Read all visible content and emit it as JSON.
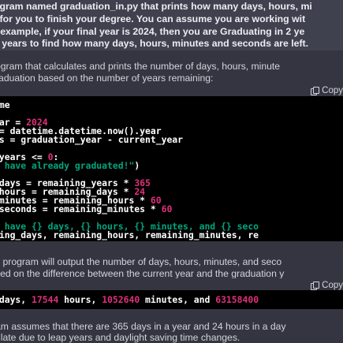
{
  "colors": {
    "page_bg": "#343541",
    "user_bg": "#40414f",
    "code_bg": "#000000",
    "number": "#df3079",
    "string": "#00a67d",
    "keyword": "#2e95d3"
  },
  "user_message": {
    "lines": [
      "ogram named graduation_in.py that prints how many days, hours, mi",
      "t for you to finish your degree. You can assume you are working wit",
      "r example, if your final year is 2024, then you are Graduating in 2 ye",
      "2 years to find how many days, hours, minutes and seconds are left."
    ]
  },
  "assistant_intro": {
    "lines": [
      "ogram that calculates and prints the number of days, hours, minute",
      "raduation based on the number of years remaining:"
    ]
  },
  "code_block_1": {
    "copy_label": "Copy",
    "lines": {
      "l1": "ime",
      "l2_a": "ear = ",
      "l2_b": "2024",
      "l3": " = datetime.datetime.now().year",
      "l4": "rs = graduation_year - current_year",
      "l5_a": "_years <= ",
      "l5_b": "0",
      "l5_c": ":",
      "l6_a": "u have already graduated!\"",
      "l6_b": ")",
      "l7_a": "_days = remaining_years * ",
      "l7_b": "365",
      "l8_a": "_hours = remaining_days * ",
      "l8_b": "24",
      "l9_a": "_minutes = remaining_hours * ",
      "l9_b": "60",
      "l10_a": "_seconds = remaining_minutes * ",
      "l10_b": "60",
      "l11": "u have {} days, {} hours, {} minutes, and {} seco",
      "l12": "ning_days, remaining_hours, remaining_minutes, re"
    }
  },
  "assistant_middle": {
    "lines": [
      "s program will output the number of days, hours, minutes, and seco",
      "sed on the difference between the current year and the graduation y"
    ]
  },
  "code_block_2": {
    "copy_label": "Copy",
    "parts": {
      "p1": " days, ",
      "p2": "17544",
      "p3": " hours, ",
      "p4": "1052640",
      "p5": " minutes, and ",
      "p6": "63158400"
    }
  },
  "assistant_end": {
    "lines": [
      "am assumes that there are 365 days in a year and 24 hours in a day",
      "ulate due to leap years and daylight saving time changes."
    ]
  }
}
